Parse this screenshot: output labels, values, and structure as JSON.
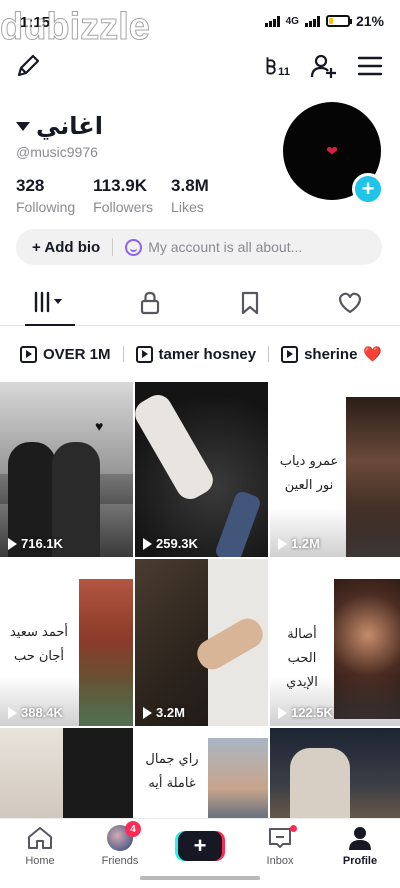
{
  "status_bar": {
    "time": "1:15",
    "network": "4G",
    "battery_percent": "21%",
    "battery_level": 0.21
  },
  "watermark": "dubizzle",
  "profile": {
    "display_name": "اغاني",
    "handle": "@music9976",
    "stats": [
      {
        "value": "328",
        "label": "Following"
      },
      {
        "value": "113.9K",
        "label": "Followers"
      },
      {
        "value": "3.8M",
        "label": "Likes"
      }
    ],
    "add_bio_label": "+ Add bio",
    "bio_placeholder": "My account is all about..."
  },
  "top_bar": {
    "icons": [
      "edit-icon",
      "stats-icon",
      "add-friend-icon",
      "menu-icon"
    ],
    "stats_badge": "11"
  },
  "tabs": [
    {
      "name": "videos-tab",
      "icon": "grid-icon",
      "active": true
    },
    {
      "name": "private-tab",
      "icon": "lock-icon",
      "active": false
    },
    {
      "name": "saved-tab",
      "icon": "bookmark-icon",
      "active": false
    },
    {
      "name": "liked-tab",
      "icon": "heart-icon",
      "active": false
    }
  ],
  "playlists": [
    {
      "label": "OVER 1M"
    },
    {
      "label": "tamer hosney"
    },
    {
      "label": "sherine",
      "emoji": "❤️"
    }
  ],
  "videos": [
    {
      "views": "716.1K"
    },
    {
      "views": "259.3K"
    },
    {
      "views": "1.2M",
      "caption_line1": "عمرو دياب",
      "caption_line2": "نور العين"
    },
    {
      "views": "388.4K",
      "caption_line1": "أحمد سعيد",
      "caption_line2": "أجان حب"
    },
    {
      "views": "3.2M"
    },
    {
      "views": "122.5K",
      "caption_line1": "أصالة",
      "caption_line2": "الحب الإيدي"
    },
    {
      "views": ""
    },
    {
      "views": "",
      "caption_line1": "راي جمال",
      "caption_line2": "غاملة أيه"
    },
    {
      "views": ""
    }
  ],
  "bottom_nav": [
    {
      "label": "Home",
      "active": false
    },
    {
      "label": "Friends",
      "badge": "4",
      "active": false
    },
    {
      "label": "",
      "active": false
    },
    {
      "label": "Inbox",
      "active": false
    },
    {
      "label": "Profile",
      "active": true
    }
  ],
  "colors": {
    "accent_cyan": "#20c4e8",
    "tiktok_red": "#fe2c55",
    "tiktok_cyan": "#25f4ee",
    "battery_yellow": "#f4c20d"
  }
}
